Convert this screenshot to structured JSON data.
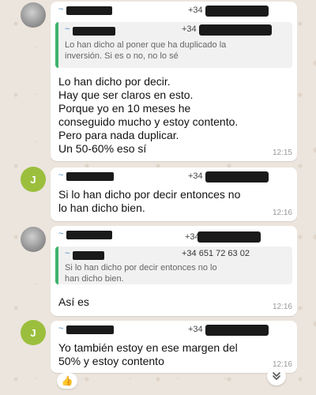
{
  "messages": [
    {
      "phone_prefix": "+34",
      "quote": {
        "phone_prefix": "+34",
        "lines": [
          "Lo han dicho al poner que ha duplicado la",
          "inversión. Si es o no, no lo sé"
        ]
      },
      "lines": [
        "Lo han dicho por decir.",
        "Hay que ser claros en esto.",
        "Porque yo en 10 meses he",
        "conseguido mucho y estoy contento.",
        "Pero para nada duplicar.",
        "Un 50-60% eso sí"
      ],
      "time": "12:15"
    },
    {
      "avatar_letter": "J",
      "phone_prefix": "+34",
      "lines": [
        "Si lo han dicho por decir entonces no",
        "lo han dicho bien."
      ],
      "time": "12:16"
    },
    {
      "phone_prefix": "+34",
      "quote": {
        "phone": "+34 651 72 63 02",
        "lines": [
          "Si lo han dicho por decir entonces no lo",
          "han dicho bien."
        ]
      },
      "lines": [
        "Así es"
      ],
      "time": "12:16"
    },
    {
      "avatar_letter": "J",
      "phone_prefix": "+34",
      "lines": [
        "Yo también estoy en ese margen del",
        "50% y estoy contento"
      ],
      "time": "12:16"
    }
  ],
  "reaction": "👍",
  "icons": {
    "scroll_down": "double-chevron-down-icon",
    "reaction": "thumbs-up-emoji"
  },
  "colors": {
    "quote_bar": "#3fb36b",
    "sender_name": "#4a8bbf",
    "avatar_green": "#9bbf3d"
  }
}
